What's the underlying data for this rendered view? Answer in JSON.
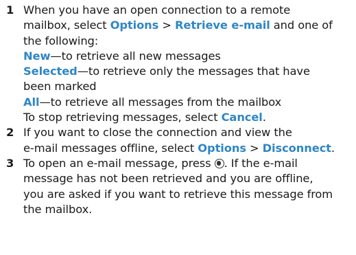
{
  "colors": {
    "text": "#1a1a1a",
    "keyword": "#2f86c6"
  },
  "steps": [
    {
      "number": "1",
      "line1": "When you have an open connection to a remote",
      "line2_pre": "mailbox, select ",
      "options": "Options",
      "sep": " > ",
      "retrieve_email": "Retrieve e-mail",
      "line2_post": " and one of",
      "line3": "the following:",
      "new_kw": "New",
      "new_desc": "—to retrieve all new messages",
      "selected_kw": "Selected",
      "selected_desc": "—to retrieve only the messages that have",
      "selected_desc2": "been marked",
      "all_kw": "All",
      "all_desc": "—to retrieve all messages from the mailbox",
      "stop_pre": "To stop retrieving messages, select ",
      "cancel": "Cancel",
      "stop_post": "."
    },
    {
      "number": "2",
      "line1": "If you want to close the connection and view the",
      "line2_pre": "e-mail messages offline, select ",
      "options": "Options",
      "sep": " > ",
      "disconnect": "Disconnect",
      "line2_post": "."
    },
    {
      "number": "3",
      "line1_pre": "To open an e-mail message, press ",
      "joystick_icon": "joystick-press-icon",
      "line1_post": ". If the e-mail",
      "line2": "message has not been retrieved and you are offline,",
      "line3": "you are asked if you want to retrieve this message from",
      "line4": "the mailbox."
    }
  ]
}
